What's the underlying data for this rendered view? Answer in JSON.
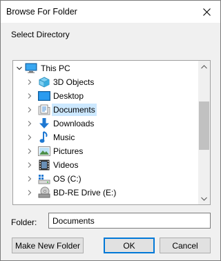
{
  "window": {
    "title": "Browse For Folder"
  },
  "instruction": "Select Directory",
  "tree": {
    "items": [
      {
        "label": "This PC",
        "icon": "computer-icon",
        "expanded": true
      },
      {
        "label": "3D Objects",
        "icon": "3d-objects-icon"
      },
      {
        "label": "Desktop",
        "icon": "desktop-icon"
      },
      {
        "label": "Documents",
        "icon": "documents-icon",
        "selected": true
      },
      {
        "label": "Downloads",
        "icon": "downloads-icon"
      },
      {
        "label": "Music",
        "icon": "music-icon"
      },
      {
        "label": "Pictures",
        "icon": "pictures-icon"
      },
      {
        "label": "Videos",
        "icon": "videos-icon"
      },
      {
        "label": "OS (C:)",
        "icon": "drive-c-icon"
      },
      {
        "label": "BD-RE Drive (E:)",
        "icon": "bd-drive-icon"
      }
    ]
  },
  "folder": {
    "label": "Folder:",
    "value": "Documents"
  },
  "buttons": {
    "new_folder": "Make New Folder",
    "ok": "OK",
    "cancel": "Cancel"
  },
  "colors": {
    "selection": "#cce8ff",
    "accent": "#0078d7"
  }
}
